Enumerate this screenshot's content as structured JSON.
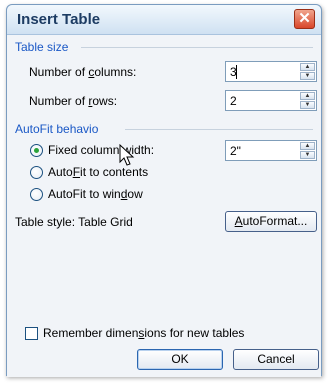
{
  "dialog": {
    "title": "Insert Table",
    "close_glyph": "✕"
  },
  "table_size": {
    "group_label": "Table size",
    "columns_label_pre": "Number of ",
    "columns_label_u": "c",
    "columns_label_post": "olumns:",
    "columns_value": "3",
    "rows_label_pre": "Number of ",
    "rows_label_u": "r",
    "rows_label_post": "ows:",
    "rows_value": "2"
  },
  "autofit": {
    "group_label": "AutoFit behavio",
    "fixed_label_pre": "Fixed column ",
    "fixed_label_u": "w",
    "fixed_label_post": "idth:",
    "fixed_value": "2\"",
    "fit_contents_pre": "Auto",
    "fit_contents_u": "F",
    "fit_contents_post": "it to contents",
    "fit_window_pre": "AutoFit to win",
    "fit_window_u": "d",
    "fit_window_post": "ow",
    "selected": "fixed"
  },
  "style": {
    "label": "Table style: Table Grid",
    "autoformat_u": "A",
    "autoformat_post": "utoFormat..."
  },
  "remember": {
    "label_pre": "Remember dimen",
    "label_u": "s",
    "label_post": "ions for new tables",
    "checked": false
  },
  "buttons": {
    "ok": "OK",
    "cancel": "Cancel"
  },
  "icons": {
    "close": "close-icon",
    "spin_up": "spin-up-icon",
    "spin_down": "spin-down-icon",
    "cursor": "mouse-pointer-icon"
  },
  "colors": {
    "group_label": "#1a58c6",
    "title": "#1d3c63",
    "close_button": "#d9462a",
    "radio_dot": "#2ba33a"
  }
}
